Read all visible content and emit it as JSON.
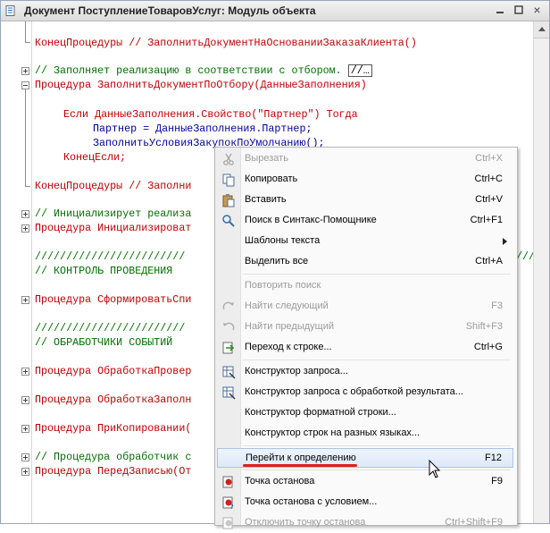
{
  "window": {
    "title": "Документ ПоступлениеТоваровУслуг: Модуль объекта",
    "close_glyph": "×"
  },
  "code": {
    "lines": [
      "КонецПроцедуры // ЗаполнитьДокументНаОснованииЗаказаКлиента()",
      "// Заполняет реализацию в соответствии с отбором.",
      "//…",
      "Процедура ЗаполнитьДокументПоОтбору(ДанныеЗаполнения)",
      "Если ДанныеЗаполнения.Свойство(\"Партнер\") Тогда",
      "Партнер = ДанныеЗаполнения.Партнер;",
      "ЗаполнитьУсловияЗакупокПоУмолчанию();",
      "КонецЕсли;",
      "КонецПроцедуры // Заполни",
      "// Инициализирует реализа",
      "Процедура Инициализироват",
      "////////////////////////",
      "////////////////////////////////////////////////////////////////////",
      "// КОНТРОЛЬ ПРОВЕДЕНИЯ",
      "Процедура СформироватьСпи",
      "////////////////////////",
      "// ОБРАБОТЧИКИ СОБЫТИЙ",
      "Процедура ОбработкаПровер",
      "Процедура ОбработкаЗаполн",
      "Процедура ПриКопировании(",
      "// Процедура обработчик с",
      "Процедура ПередЗаписью(От"
    ]
  },
  "context_menu": {
    "items": [
      {
        "label": "Вырезать",
        "shortcut": "Ctrl+X",
        "icon": "scissors-icon",
        "enabled": false
      },
      {
        "label": "Копировать",
        "shortcut": "Ctrl+C",
        "icon": "copy-icon",
        "enabled": true
      },
      {
        "label": "Вставить",
        "shortcut": "Ctrl+V",
        "icon": "paste-icon",
        "enabled": true
      },
      {
        "label": "Поиск в Синтакс-Помощнике",
        "shortcut": "Ctrl+F1",
        "icon": "syntax-helper-search-icon",
        "enabled": true
      },
      {
        "label": "Шаблоны текста",
        "shortcut": "",
        "icon": "",
        "enabled": true,
        "submenu": true
      },
      {
        "label": "Выделить все",
        "shortcut": "Ctrl+A",
        "icon": "",
        "enabled": true
      },
      {
        "label": "Повторить поиск",
        "shortcut": "",
        "icon": "",
        "enabled": false
      },
      {
        "label": "Найти следующий",
        "shortcut": "F3",
        "icon": "find-next-icon",
        "enabled": false
      },
      {
        "label": "Найти предыдущий",
        "shortcut": "Shift+F3",
        "icon": "find-previous-icon",
        "enabled": false
      },
      {
        "label": "Переход к строке...",
        "shortcut": "Ctrl+G",
        "icon": "goto-line-icon",
        "enabled": true
      },
      {
        "label": "Конструктор запроса...",
        "shortcut": "",
        "icon": "query-builder-icon",
        "enabled": true
      },
      {
        "label": "Конструктор запроса с обработкой результата...",
        "shortcut": "",
        "icon": "query-builder-result-icon",
        "enabled": true
      },
      {
        "label": "Конструктор форматной строки...",
        "shortcut": "",
        "icon": "",
        "enabled": true
      },
      {
        "label": "Конструктор строк на разных языках...",
        "shortcut": "",
        "icon": "",
        "enabled": true
      },
      {
        "label": "Перейти к определению",
        "shortcut": "F12",
        "icon": "",
        "enabled": true,
        "selected": true
      },
      {
        "label": "Точка останова",
        "shortcut": "F9",
        "icon": "breakpoint-icon",
        "enabled": true
      },
      {
        "label": "Точка останова с условием...",
        "shortcut": "",
        "icon": "conditional-breakpoint-icon",
        "enabled": true
      },
      {
        "label": "Отключить точку останова",
        "shortcut": "Ctrl+Shift+F9",
        "icon": "disable-breakpoint-icon",
        "enabled": false
      }
    ]
  },
  "colors": {
    "keyword": "#c00000",
    "comment": "#007000",
    "identifier": "#0000a0",
    "highlight_underline": "#e0201c"
  }
}
